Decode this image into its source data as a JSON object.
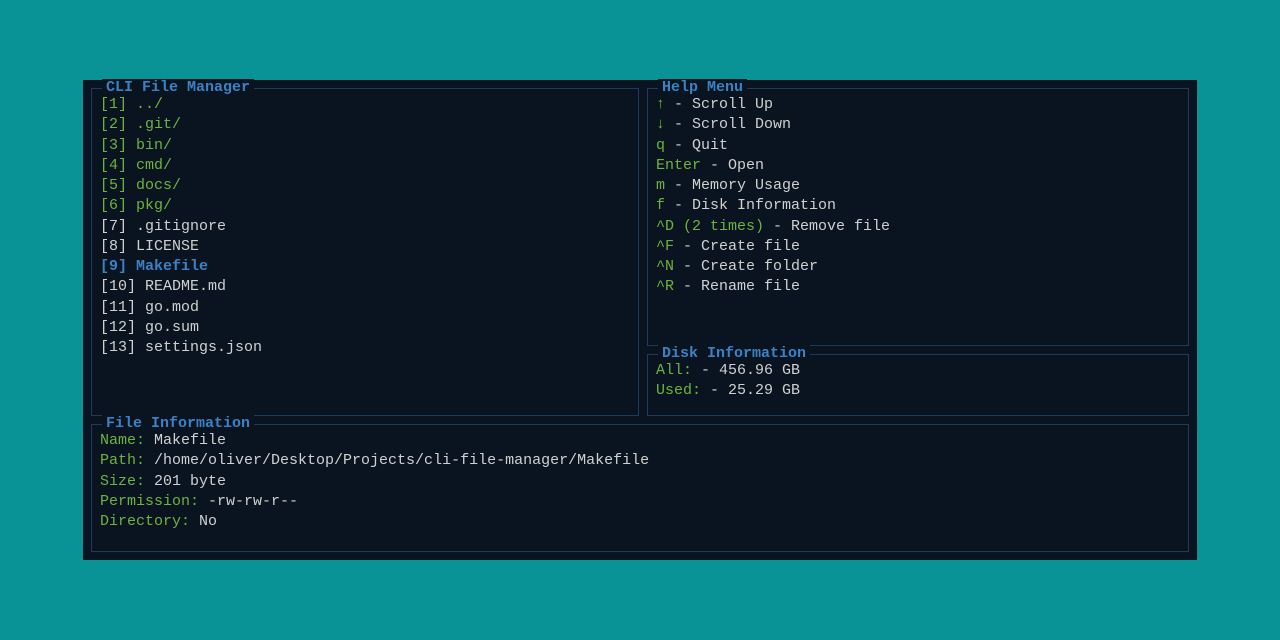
{
  "panels": {
    "files": {
      "title": "CLI File Manager",
      "items": [
        {
          "index": "[1]",
          "name": "../",
          "type": "dir",
          "selected": false
        },
        {
          "index": "[2]",
          "name": ".git/",
          "type": "dir",
          "selected": false
        },
        {
          "index": "[3]",
          "name": "bin/",
          "type": "dir",
          "selected": false
        },
        {
          "index": "[4]",
          "name": "cmd/",
          "type": "dir",
          "selected": false
        },
        {
          "index": "[5]",
          "name": "docs/",
          "type": "dir",
          "selected": false
        },
        {
          "index": "[6]",
          "name": "pkg/",
          "type": "dir",
          "selected": false
        },
        {
          "index": "[7]",
          "name": ".gitignore",
          "type": "file",
          "selected": false
        },
        {
          "index": "[8]",
          "name": "LICENSE",
          "type": "file",
          "selected": false
        },
        {
          "index": "[9]",
          "name": "Makefile",
          "type": "file",
          "selected": true
        },
        {
          "index": "[10]",
          "name": "README.md",
          "type": "file",
          "selected": false
        },
        {
          "index": "[11]",
          "name": "go.mod",
          "type": "file",
          "selected": false
        },
        {
          "index": "[12]",
          "name": "go.sum",
          "type": "file",
          "selected": false
        },
        {
          "index": "[13]",
          "name": "settings.json",
          "type": "file",
          "selected": false
        }
      ]
    },
    "help": {
      "title": "Help Menu",
      "items": [
        {
          "key": "↑",
          "desc": "Scroll Up"
        },
        {
          "key": "↓",
          "desc": "Scroll Down"
        },
        {
          "key": "q",
          "desc": "Quit"
        },
        {
          "key": "Enter",
          "desc": "Open"
        },
        {
          "key": "m",
          "desc": "Memory Usage"
        },
        {
          "key": "f",
          "desc": "Disk Information"
        },
        {
          "key": "^D (2 times)",
          "desc": "Remove file"
        },
        {
          "key": "^F",
          "desc": "Create file"
        },
        {
          "key": "^N",
          "desc": "Create folder"
        },
        {
          "key": "^R",
          "desc": "Rename file"
        }
      ]
    },
    "disk": {
      "title": "Disk Information",
      "rows": [
        {
          "label": "All: ",
          "value": " - 456.96 GB"
        },
        {
          "label": "Used:",
          "value": " - 25.29 GB"
        }
      ]
    },
    "fileinfo": {
      "title": "File Information",
      "rows": [
        {
          "label": "Name:",
          "value": " Makefile"
        },
        {
          "label": "Path:",
          "value": " /home/oliver/Desktop/Projects/cli-file-manager/Makefile"
        },
        {
          "label": "Size:",
          "value": " 201 byte"
        },
        {
          "label": "Permission:",
          "value": " -rw-rw-r--"
        },
        {
          "label": "Directory:",
          "value": " No"
        }
      ]
    }
  }
}
